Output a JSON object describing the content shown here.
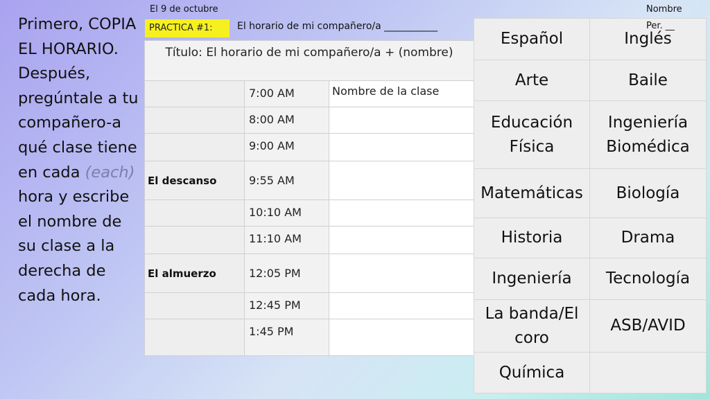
{
  "instructions": {
    "part1": "Primero, COPIA EL HORARIO. Después, pregúntale a tu compañero-a qué clase tiene en cada",
    "each": "(each)",
    "part2": "hora y escribe el nombre de su clase a la derecha de cada hora."
  },
  "header": {
    "date": "El 9 de octubre",
    "name_label": "Nombre",
    "per_label": "Per. __",
    "badge": "PRACTICA #1:",
    "line": "El horario de mi compañero/a ___________"
  },
  "schedule": {
    "title": "Título:  El horario de mi compañero/a + (nombre)",
    "rows": [
      {
        "label": "",
        "time": "7:00 AM",
        "class": "Nombre de la clase"
      },
      {
        "label": "",
        "time": "8:00 AM",
        "class": ""
      },
      {
        "label": "",
        "time": "9:00 AM",
        "class": ""
      },
      {
        "label": "El descanso",
        "time": "9:55 AM",
        "class": ""
      },
      {
        "label": "",
        "time": "10:10 AM",
        "class": ""
      },
      {
        "label": "",
        "time": "11:10 AM",
        "class": ""
      },
      {
        "label": "El almuerzo",
        "time": "12:05 PM",
        "class": ""
      },
      {
        "label": "",
        "time": "12:45 PM",
        "class": ""
      },
      {
        "label": "",
        "time": "1:45 PM",
        "class": ""
      }
    ]
  },
  "classes": [
    [
      "Español",
      "Inglés"
    ],
    [
      "Arte",
      "Baile"
    ],
    [
      "Educación Física",
      "Ingeniería Biomédica"
    ],
    [
      "Matemáticas",
      "Biología"
    ],
    [
      "Historia",
      "Drama"
    ],
    [
      "Ingeniería",
      "Tecnología"
    ],
    [
      "La banda/El coro",
      "ASB/AVID"
    ],
    [
      "Química",
      ""
    ]
  ]
}
